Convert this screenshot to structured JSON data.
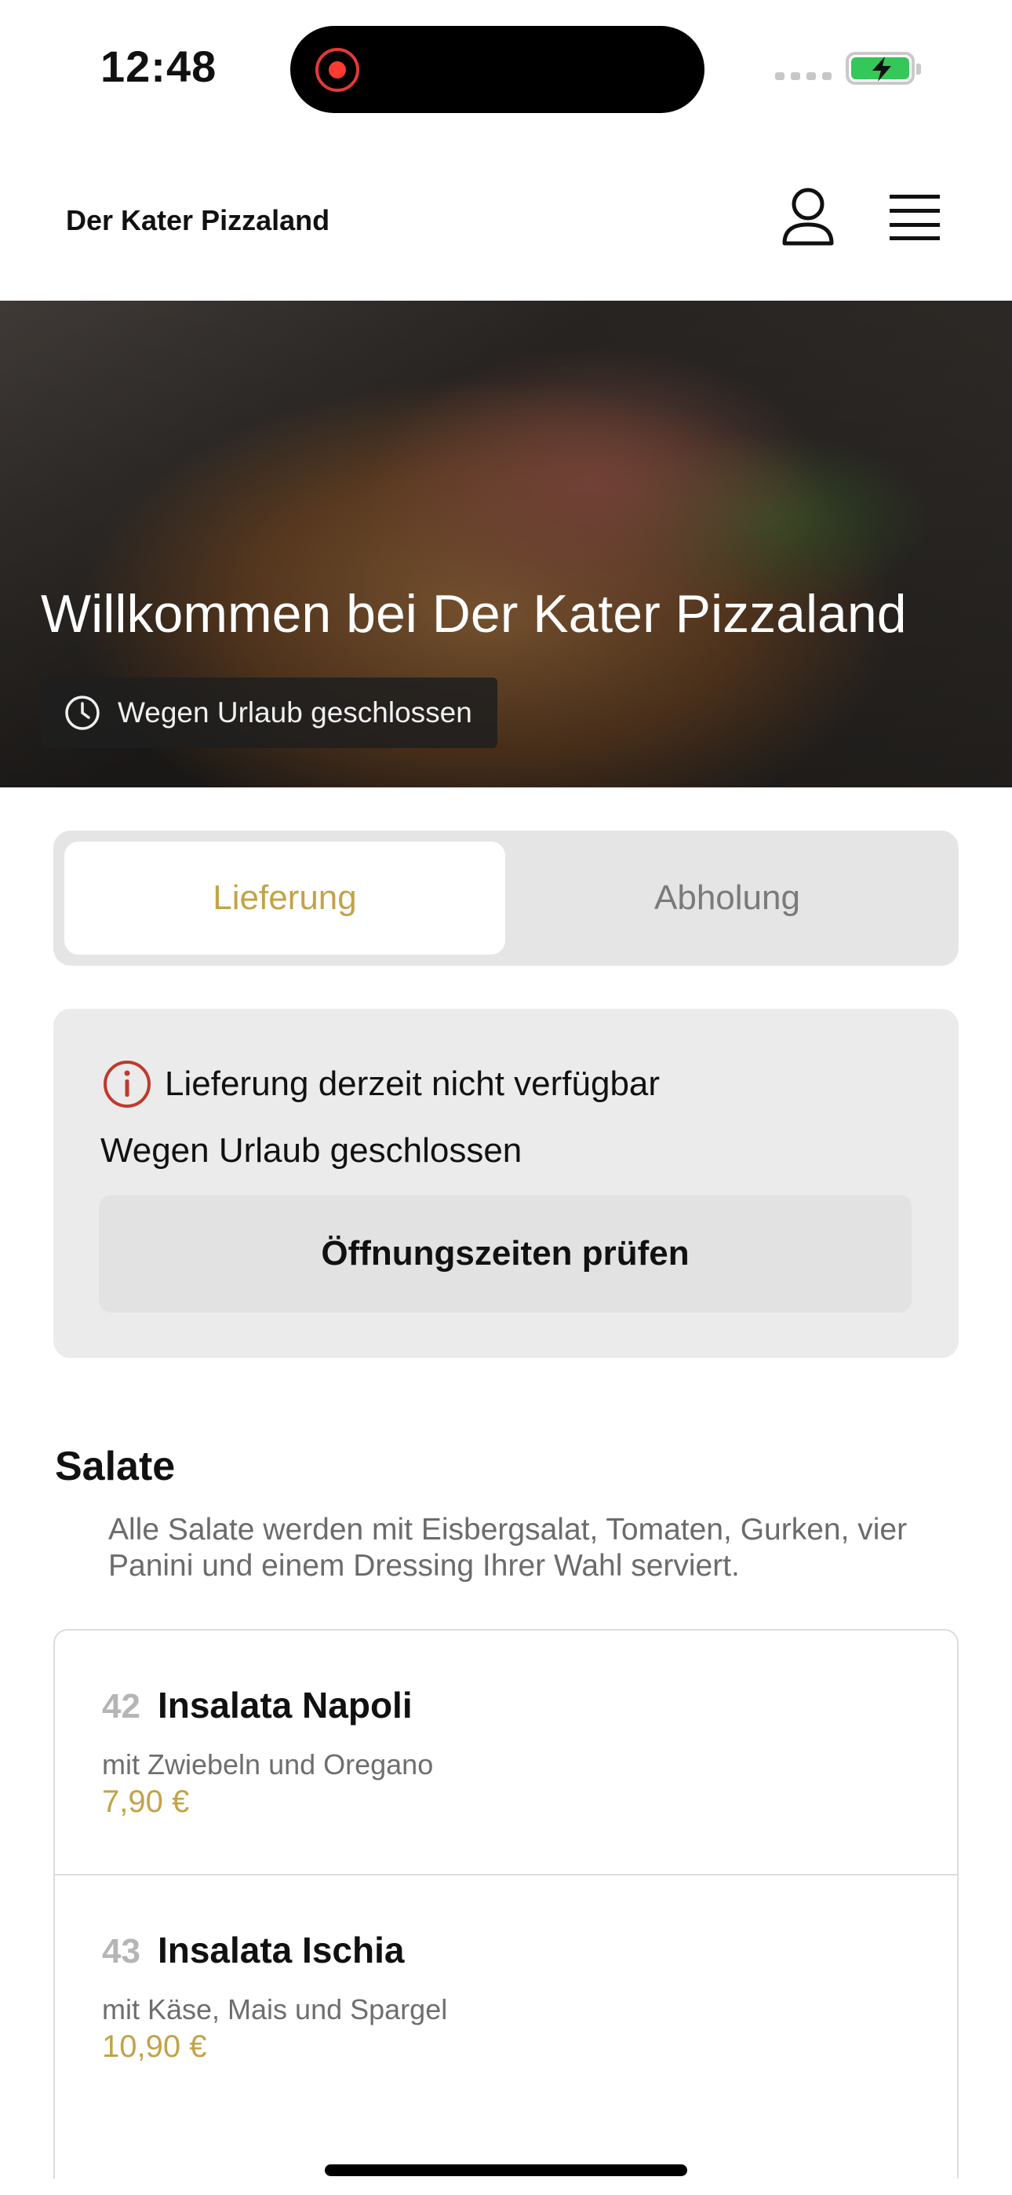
{
  "status_bar": {
    "time": "12:48"
  },
  "header": {
    "brand": "Der Kater Pizzaland",
    "account_icon": "user-outline-icon",
    "menu_icon": "hamburger-menu-icon"
  },
  "hero": {
    "title": "Willkommen bei Der Kater Pizzaland",
    "status_badge": "Wegen Urlaub geschlossen",
    "badge_icon": "clock-icon"
  },
  "order_mode": {
    "options": [
      "Lieferung",
      "Abholung"
    ],
    "selected": "Lieferung"
  },
  "notice": {
    "icon": "info-circle-icon",
    "title": "Lieferung derzeit nicht verfügbar",
    "subtitle": "Wegen Urlaub geschlossen",
    "button_label": "Öffnungszeiten prüfen"
  },
  "section": {
    "title": "Salate",
    "description": "Alle Salate werden mit Eisbergsalat, Tomaten, Gurken, vier Panini und einem Dressing Ihrer Wahl serviert."
  },
  "items": [
    {
      "number": "42",
      "name": "Insalata Napoli",
      "description": "mit Zwiebeln und Oregano",
      "price": "7,90 €"
    },
    {
      "number": "43",
      "name": "Insalata Ischia",
      "description": "mit Käse, Mais und Spargel",
      "price": "10,90 €"
    }
  ],
  "colors": {
    "accent": "#c2a34a",
    "alert": "#c0392b",
    "battery": "#34c759"
  }
}
